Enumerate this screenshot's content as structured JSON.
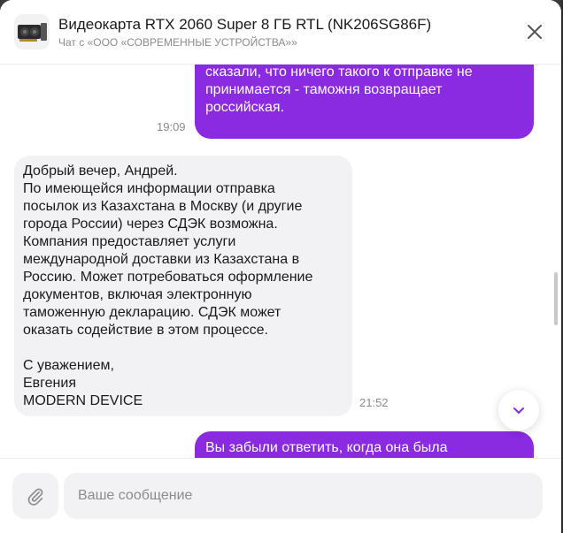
{
  "header": {
    "title": "Видеокарта RTX 2060 Super 8 ГБ RTL (NK206SG86F)",
    "subtitle": "Чат с «ООО «СОВРЕМЕННЫЕ УСТРОЙСТВА»»",
    "close_icon": "close-icon",
    "thumb_icon": "graphics-card-image"
  },
  "messages": [
    {
      "direction": "outgoing",
      "text": "было. Потому что вот буквально вчера мне\nсказали, что ничего такого к отправке не\nпринимается - таможня возвращает\nроссийская.",
      "time": "19:09"
    },
    {
      "direction": "incoming",
      "text": "Добрый вечер, Андрей.\nПо имеющейся информации отправка\nпосылок из Казахстана в Москву (и другие\nгорода России) через СДЭК возможна.\nКомпания предоставляет услуги\nмеждународной доставки из Казахстана в\nРоссию. Может потребоваться оформление\nдокументов, включая электронную\nтаможенную декларацию. СДЭК может\nоказать содействие в этом процессе.\n\nС уважением,\nЕвгения\nMODERN DEVICE",
      "time": "21:52"
    },
    {
      "direction": "outgoing",
      "text": "Вы забыли ответить, когда она была",
      "time": ""
    }
  ],
  "composer": {
    "placeholder": "Ваше сообщение",
    "attach_icon": "paperclip-icon"
  },
  "scroll_button": {
    "icon": "chevron-down-icon"
  },
  "colors": {
    "outgoing_bubble": "#8a2be2",
    "incoming_bubble": "#f2f2f4",
    "timestamp": "#8b8b8b"
  }
}
